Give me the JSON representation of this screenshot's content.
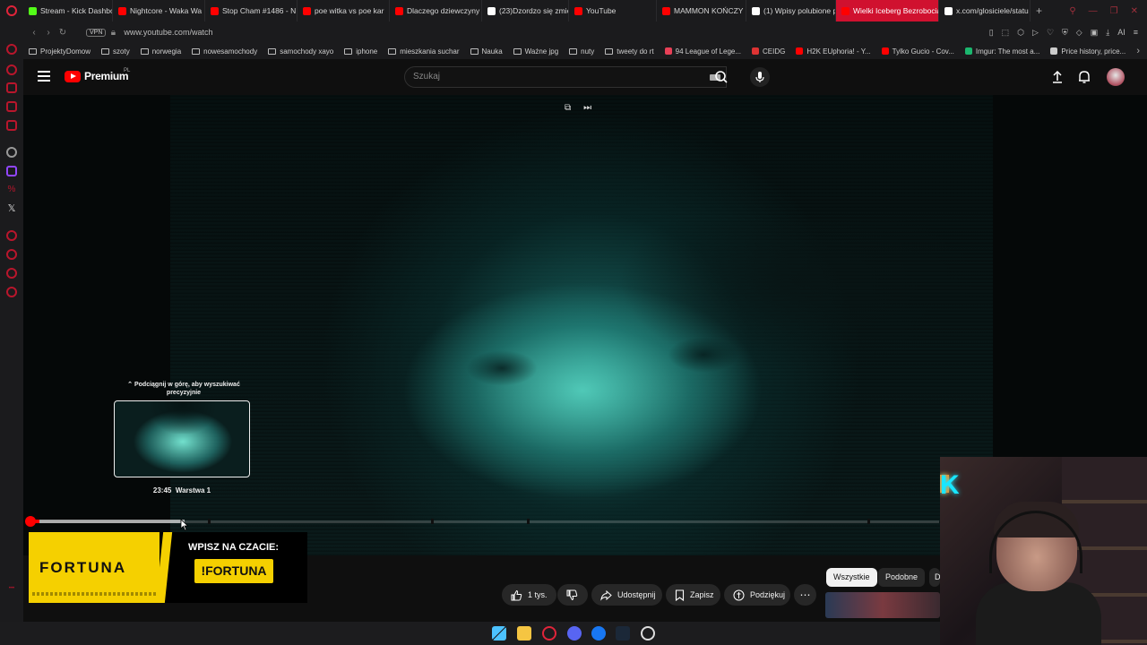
{
  "browser": {
    "tabs": [
      {
        "label": "Stream - Kick Dashbo",
        "color": "#53fc18"
      },
      {
        "label": "Nightcore - Waka Wa",
        "color": "#ff0000"
      },
      {
        "label": "Stop Cham #1486 - N",
        "color": "#ff0000"
      },
      {
        "label": "poe witka vs poe kar",
        "color": "#ff0000"
      },
      {
        "label": "Dlaczego dziewczyny",
        "color": "#ff0000"
      },
      {
        "label": "(23)Dzordzo się zmie",
        "color": "#ffffff"
      },
      {
        "label": "YouTube",
        "color": "#ff0000"
      },
      {
        "label": "MAMMON KOŃCZY H",
        "color": "#ff0000"
      },
      {
        "label": "(1) Wpisy polubione p",
        "color": "#ffffff"
      },
      {
        "label": "Wielki Iceberg Bezrobocia",
        "color": "#ff0000",
        "active": true
      },
      {
        "label": "x.com/glosiciele/statu",
        "color": "#ffffff"
      }
    ],
    "new_tab": "+",
    "vpn_label": "VPN",
    "url": "www.youtube.com/watch",
    "ai_label": "AI",
    "bookmarks": [
      {
        "label": "ProjektyDomow",
        "type": "folder"
      },
      {
        "label": "szoty",
        "type": "folder"
      },
      {
        "label": "norwegia",
        "type": "folder"
      },
      {
        "label": "nowesamochody",
        "type": "folder"
      },
      {
        "label": "samochody xayo",
        "type": "folder"
      },
      {
        "label": "iphone",
        "type": "folder"
      },
      {
        "label": "mieszkania suchar",
        "type": "folder"
      },
      {
        "label": "Nauka",
        "type": "folder"
      },
      {
        "label": "Ważne jpg",
        "type": "folder"
      },
      {
        "label": "nuty",
        "type": "folder"
      },
      {
        "label": "tweety do rt",
        "type": "folder"
      },
      {
        "label": "94 League of Lege...",
        "type": "site",
        "color": "#e84057"
      },
      {
        "label": "CEIDG",
        "type": "site",
        "color": "#d33"
      },
      {
        "label": "H2K EUphoria! - Y...",
        "type": "site",
        "color": "#ff0000"
      },
      {
        "label": "Tylko Gucio - Cov...",
        "type": "site",
        "color": "#ff0000"
      },
      {
        "label": "Imgur: The most a...",
        "type": "site",
        "color": "#1bb76e"
      },
      {
        "label": "Price history, price...",
        "type": "site",
        "color": "#cccccc"
      }
    ]
  },
  "youtube": {
    "logo_text": "Premium",
    "region": "PL",
    "search_placeholder": "Szukaj",
    "accent": "#ff0000"
  },
  "player": {
    "scrub_hint": "Podciągnij w górę, aby wyszukiwać precyzyjnie",
    "preview_time": "23:45",
    "preview_chapter": "Warstwa 1",
    "progress_played": 0.011,
    "progress_hover": 0.17
  },
  "ad": {
    "brand": "FORTUNA",
    "headline": "WPISZ NA CZACIE:",
    "command": "!FORTUNA"
  },
  "actions": {
    "likes": "1 tys.",
    "share": "Udostępnij",
    "save": "Zapisz",
    "thanks": "Podziękuj",
    "more": "⋯"
  },
  "chips": {
    "all": "Wszystkie",
    "related": "Podobne",
    "third": "D"
  }
}
